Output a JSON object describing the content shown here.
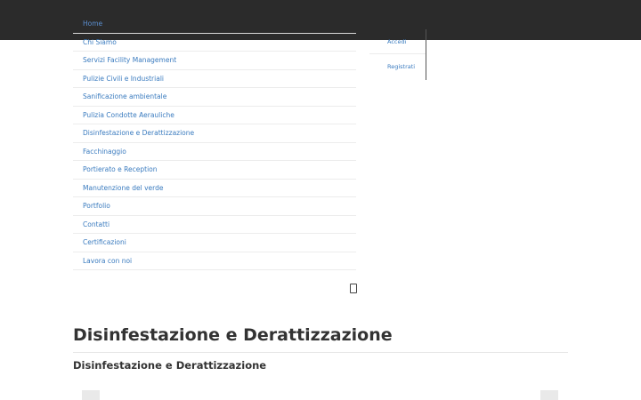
{
  "nav": {
    "items": [
      {
        "label": "Home",
        "icon": "square-glyph-icon"
      },
      {
        "label": "Chi Siamo",
        "icon": "square-glyph-icon"
      },
      {
        "label": "Servizi Facility Management",
        "icon": "square-glyph-icon"
      },
      {
        "label": "Pulizie Civili e Industriali",
        "icon": "square-glyph-icon"
      },
      {
        "label": "Sanificazione ambientale",
        "icon": "square-glyph-icon"
      },
      {
        "label": "Pulizia Condotte Aerauliche",
        "icon": "square-glyph-icon"
      },
      {
        "label": "Disinfestazione e Derattizzazione",
        "icon": "square-glyph-icon"
      },
      {
        "label": "Facchinaggio",
        "icon": "square-glyph-icon"
      },
      {
        "label": "Portierato e Reception",
        "icon": "square-glyph-icon"
      },
      {
        "label": "Manutenzione del verde",
        "icon": "square-glyph-icon"
      },
      {
        "label": "Portfolio",
        "icon": "square-glyph-icon"
      },
      {
        "label": "Contatti",
        "icon": "square-glyph-icon"
      },
      {
        "label": "Certificazioni",
        "icon": "square-glyph-icon"
      },
      {
        "label": "Lavora con noi",
        "icon": "square-glyph-icon"
      }
    ]
  },
  "user_menu": {
    "login_label": "Accedi",
    "register_label": "Registrati"
  },
  "icon_glyph": "",
  "page": {
    "title": "Disinfestazione e Derattizzazione",
    "subtitle": "Disinfestazione e Derattizzazione"
  },
  "colors": {
    "topbar": "#2b2b2b",
    "link": "#3a7bbf",
    "heading": "#333333"
  }
}
